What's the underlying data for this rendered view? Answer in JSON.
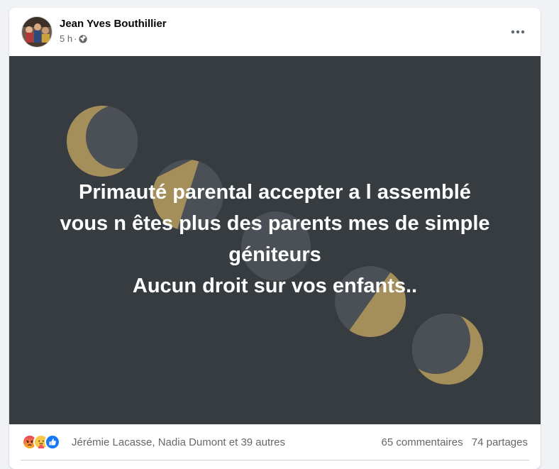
{
  "post": {
    "author": "Jean Yves Bouthillier",
    "time": "5 h",
    "separator": "·",
    "privacy_icon": "globe-icon",
    "more_icon": "more-horizontal-icon",
    "background_color": "#373c40",
    "moon_colors": {
      "lit": "#a48e5a",
      "dark": "#4a5055"
    },
    "text_lines": [
      "Primauté parental accepter a l assemblé",
      "vous n êtes plus des parents mes de simple",
      "géniteurs",
      "Aucun droit sur vos enfants.."
    ]
  },
  "footer": {
    "reaction_icons": [
      "angry-icon",
      "care-icon",
      "like-icon"
    ],
    "reactors": "Jérémie Lacasse, Nadia Dumont et 39 autres",
    "comments": "65 commentaires",
    "shares": "74 partages"
  }
}
